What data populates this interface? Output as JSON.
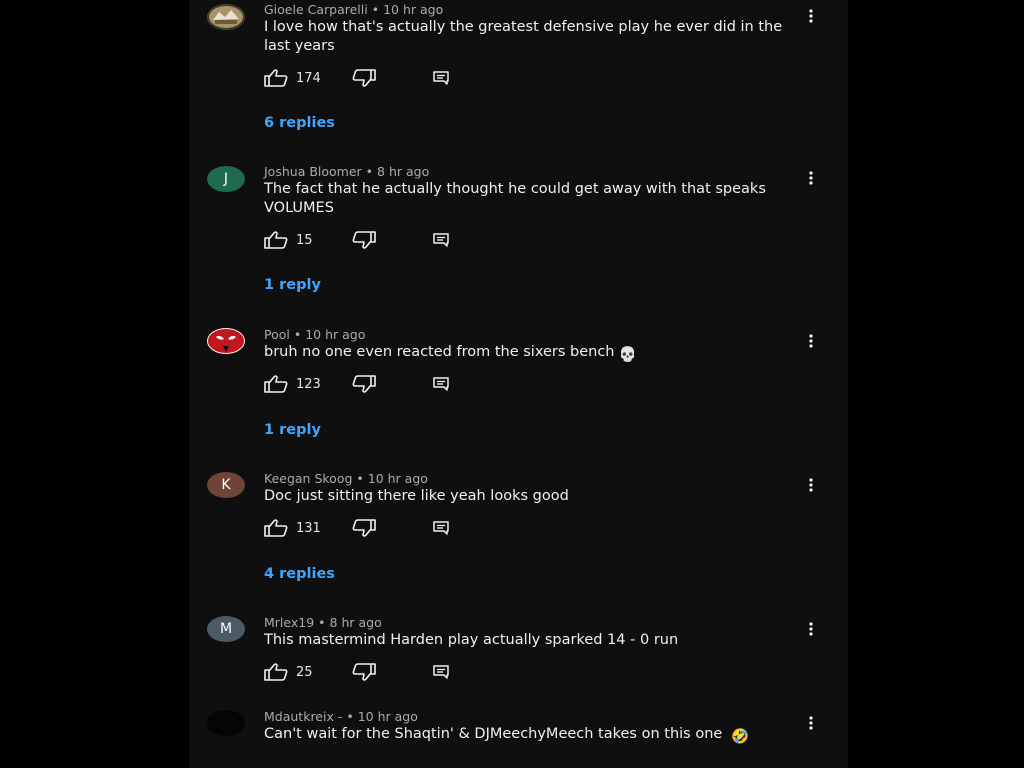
{
  "comments": [
    {
      "author": "Gioele Carparelli",
      "time": "10 hr ago",
      "text": "I love how that's actually the greatest defensive play he ever did in the last years",
      "likes": "174",
      "replies": "6 replies",
      "avatar": {
        "type": "image",
        "icon": "profile-photo",
        "color": "#8c7a55"
      }
    },
    {
      "author": "Joshua Bloomer",
      "time": "8 hr ago",
      "text": "The fact that he actually thought he could get away with that speaks VOLUMES",
      "likes": "15",
      "replies": "1 reply",
      "avatar": {
        "type": "letter",
        "letter": "J",
        "color": "#1f6b4e"
      }
    },
    {
      "author": "Pool",
      "time": "10 hr ago",
      "text": "bruh no one even reacted from the sixers bench",
      "emoji": "💀",
      "likes": "123",
      "replies": "1 reply",
      "avatar": {
        "type": "image",
        "icon": "masked-hero-avatar",
        "color": "#c0171f"
      }
    },
    {
      "author": "Keegan Skoog",
      "time": "10 hr ago",
      "text": "Doc just sitting there like yeah looks good",
      "likes": "131",
      "replies": "4 replies",
      "avatar": {
        "type": "letter",
        "letter": "K",
        "color": "#6e4436"
      }
    },
    {
      "author": "Mrlex19",
      "time": "8 hr ago",
      "text": "This mastermind Harden play actually sparked 14 - 0 run",
      "likes": "25",
      "replies": "",
      "avatar": {
        "type": "letter",
        "letter": "M",
        "color": "#4a5a66"
      }
    },
    {
      "author": "Mdautkreix -",
      "time": "10 hr ago",
      "text": "Can't wait for the Shaqtin' & DJMeechyMeech takes on this one",
      "emoji": "🤣",
      "likes": "",
      "replies": "",
      "avatar": {
        "type": "image",
        "icon": "dark-avatar",
        "color": "#050505"
      }
    }
  ],
  "ui": {
    "separator": "•",
    "text_color": "#f1f1f1",
    "meta_color": "#aaaaaa",
    "link_color": "#3ea6ff",
    "background": "#0f0f0f"
  }
}
